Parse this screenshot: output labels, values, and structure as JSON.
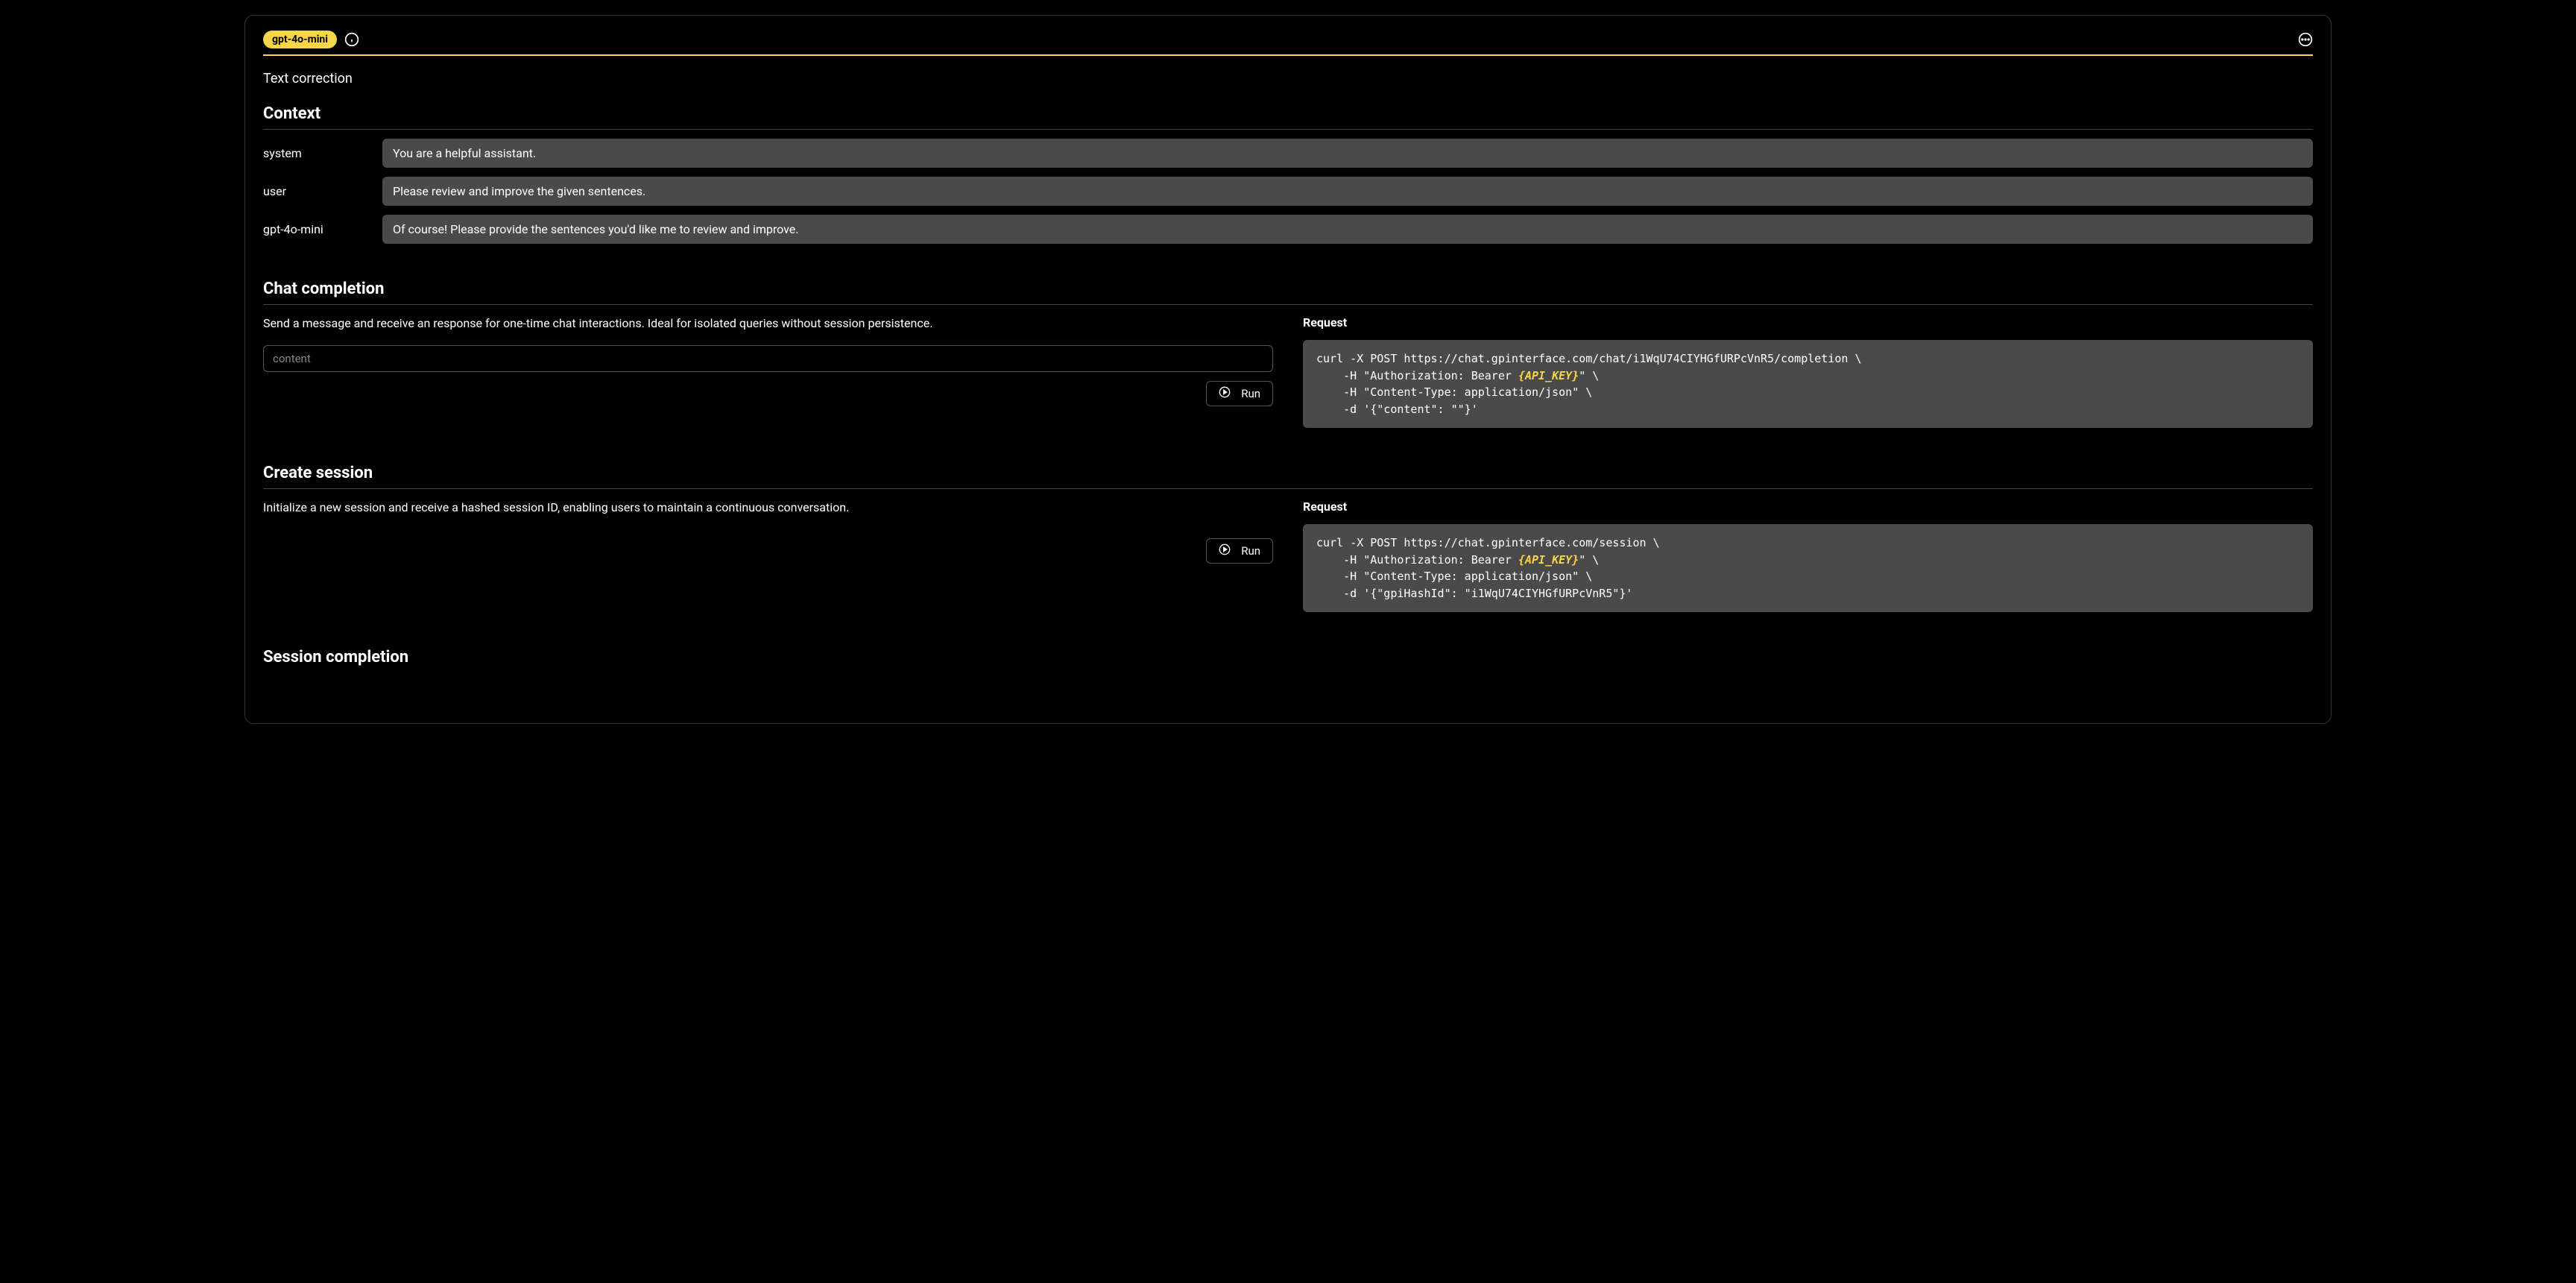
{
  "header": {
    "model_badge": "gpt-4o-mini"
  },
  "page_title": "Text correction",
  "context": {
    "heading": "Context",
    "rows": [
      {
        "role": "system",
        "content": "You are a helpful assistant."
      },
      {
        "role": "user",
        "content": "Please review and improve the given sentences."
      },
      {
        "role": "gpt-4o-mini",
        "content": "Of course! Please provide the sentences you'd like me to review and improve."
      }
    ]
  },
  "chat_completion": {
    "heading": "Chat completion",
    "description": "Send a message and receive an response for one-time chat interactions. Ideal for isolated queries without session persistence.",
    "input_placeholder": "content",
    "run_label": "Run",
    "request_label": "Request",
    "code": {
      "line1": "curl -X POST https://chat.gpinterface.com/chat/i1WqU74CIYHGfURPcVnR5/completion \\",
      "line2a": "    -H \"Authorization: Bearer ",
      "api_key": "{API_KEY}",
      "line2b": "\" \\",
      "line3": "    -H \"Content-Type: application/json\" \\",
      "line4": "    -d '{\"content\": \"\"}'"
    }
  },
  "create_session": {
    "heading": "Create session",
    "description": "Initialize a new session and receive a hashed session ID, enabling users to maintain a continuous conversation.",
    "run_label": "Run",
    "request_label": "Request",
    "code": {
      "line1": "curl -X POST https://chat.gpinterface.com/session \\",
      "line2a": "    -H \"Authorization: Bearer ",
      "api_key": "{API_KEY}",
      "line2b": "\" \\",
      "line3": "    -H \"Content-Type: application/json\" \\",
      "line4": "    -d '{\"gpiHashId\": \"i1WqU74CIYHGfURPcVnR5\"}'"
    }
  },
  "session_completion": {
    "heading": "Session completion"
  }
}
